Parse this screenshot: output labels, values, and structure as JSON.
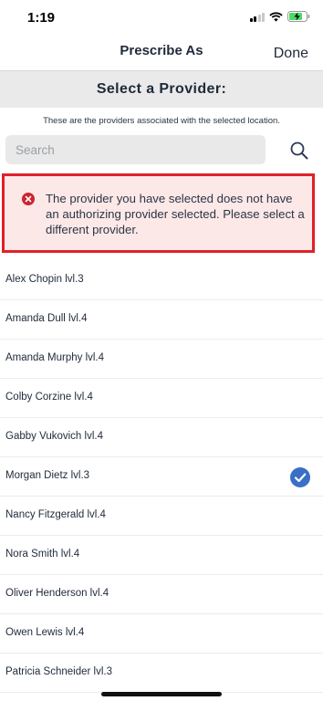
{
  "status_bar": {
    "time": "1:19"
  },
  "nav": {
    "title": "Prescribe As",
    "done_label": "Done"
  },
  "section": {
    "title": "Select a Provider:"
  },
  "subtitle": "These are the providers associated with the selected location.",
  "search": {
    "placeholder": "Search",
    "value": ""
  },
  "error": {
    "message": "The provider you have selected does not have an authorizing provider selected. Please select a different provider."
  },
  "providers": [
    {
      "name": "Alex Chopin lvl.3",
      "selected": false
    },
    {
      "name": "Amanda Dull lvl.4",
      "selected": false
    },
    {
      "name": "Amanda Murphy lvl.4",
      "selected": false
    },
    {
      "name": "Colby Corzine lvl.4",
      "selected": false
    },
    {
      "name": "Gabby Vukovich lvl.4",
      "selected": false
    },
    {
      "name": "Morgan Dietz lvl.3",
      "selected": true
    },
    {
      "name": "Nancy Fitzgerald lvl.4",
      "selected": false
    },
    {
      "name": "Nora Smith lvl.4",
      "selected": false
    },
    {
      "name": "Oliver Henderson lvl.4",
      "selected": false
    },
    {
      "name": "Owen Lewis lvl.4",
      "selected": false
    },
    {
      "name": "Patricia Schneider lvl.3",
      "selected": false
    }
  ],
  "colors": {
    "error_border": "#e0202a",
    "error_background": "#fde8e8",
    "accent": "#3a6fc7",
    "section_background": "#eaeaea"
  },
  "icons": {
    "search": "search-icon",
    "error": "error-icon",
    "check": "checkmark-circle-icon"
  }
}
